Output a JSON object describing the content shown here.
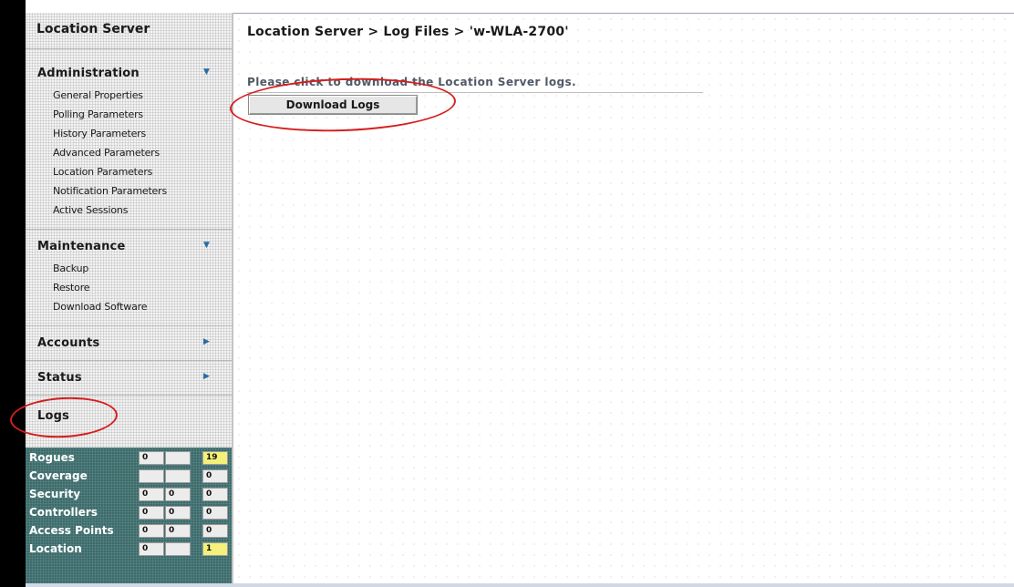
{
  "sidebar": {
    "title": "Location Server",
    "sections": [
      {
        "label": "Administration",
        "arrow": "▼",
        "items": [
          "General Properties",
          "Polling Parameters",
          "History Parameters",
          "Advanced Parameters",
          "Location Parameters",
          "Notification Parameters",
          "Active Sessions"
        ]
      },
      {
        "label": "Maintenance",
        "arrow": "▼",
        "items": [
          "Backup",
          "Restore",
          "Download Software"
        ]
      },
      {
        "label": "Accounts",
        "arrow": "▶",
        "items": []
      },
      {
        "label": "Status",
        "arrow": "▶",
        "items": []
      },
      {
        "label": "Logs",
        "arrow": "",
        "items": []
      }
    ]
  },
  "stats": {
    "rows": [
      {
        "name": "Rogues",
        "values": [
          "0",
          "",
          "19"
        ],
        "highlight": [
          false,
          false,
          true
        ]
      },
      {
        "name": "Coverage",
        "values": [
          "",
          "",
          "0"
        ],
        "highlight": [
          false,
          false,
          false
        ]
      },
      {
        "name": "Security",
        "values": [
          "0",
          "0",
          "0"
        ],
        "highlight": [
          false,
          false,
          false
        ]
      },
      {
        "name": "Controllers",
        "values": [
          "0",
          "0",
          "0"
        ],
        "highlight": [
          false,
          false,
          false
        ]
      },
      {
        "name": "Access Points",
        "values": [
          "0",
          "0",
          "0"
        ],
        "highlight": [
          false,
          false,
          false
        ]
      },
      {
        "name": "Location",
        "values": [
          "0",
          "",
          "1"
        ],
        "highlight": [
          false,
          false,
          true
        ]
      }
    ]
  },
  "main": {
    "breadcrumb": "Location Server > Log Files > 'w-WLA-2700'",
    "instruction": "Please click to download the Location Server logs.",
    "download_button": "Download Logs"
  },
  "colors": {
    "annotation": "#d61e1e",
    "stats_bg": "#3d6b6b",
    "highlight_cell": "#f4f07a"
  }
}
